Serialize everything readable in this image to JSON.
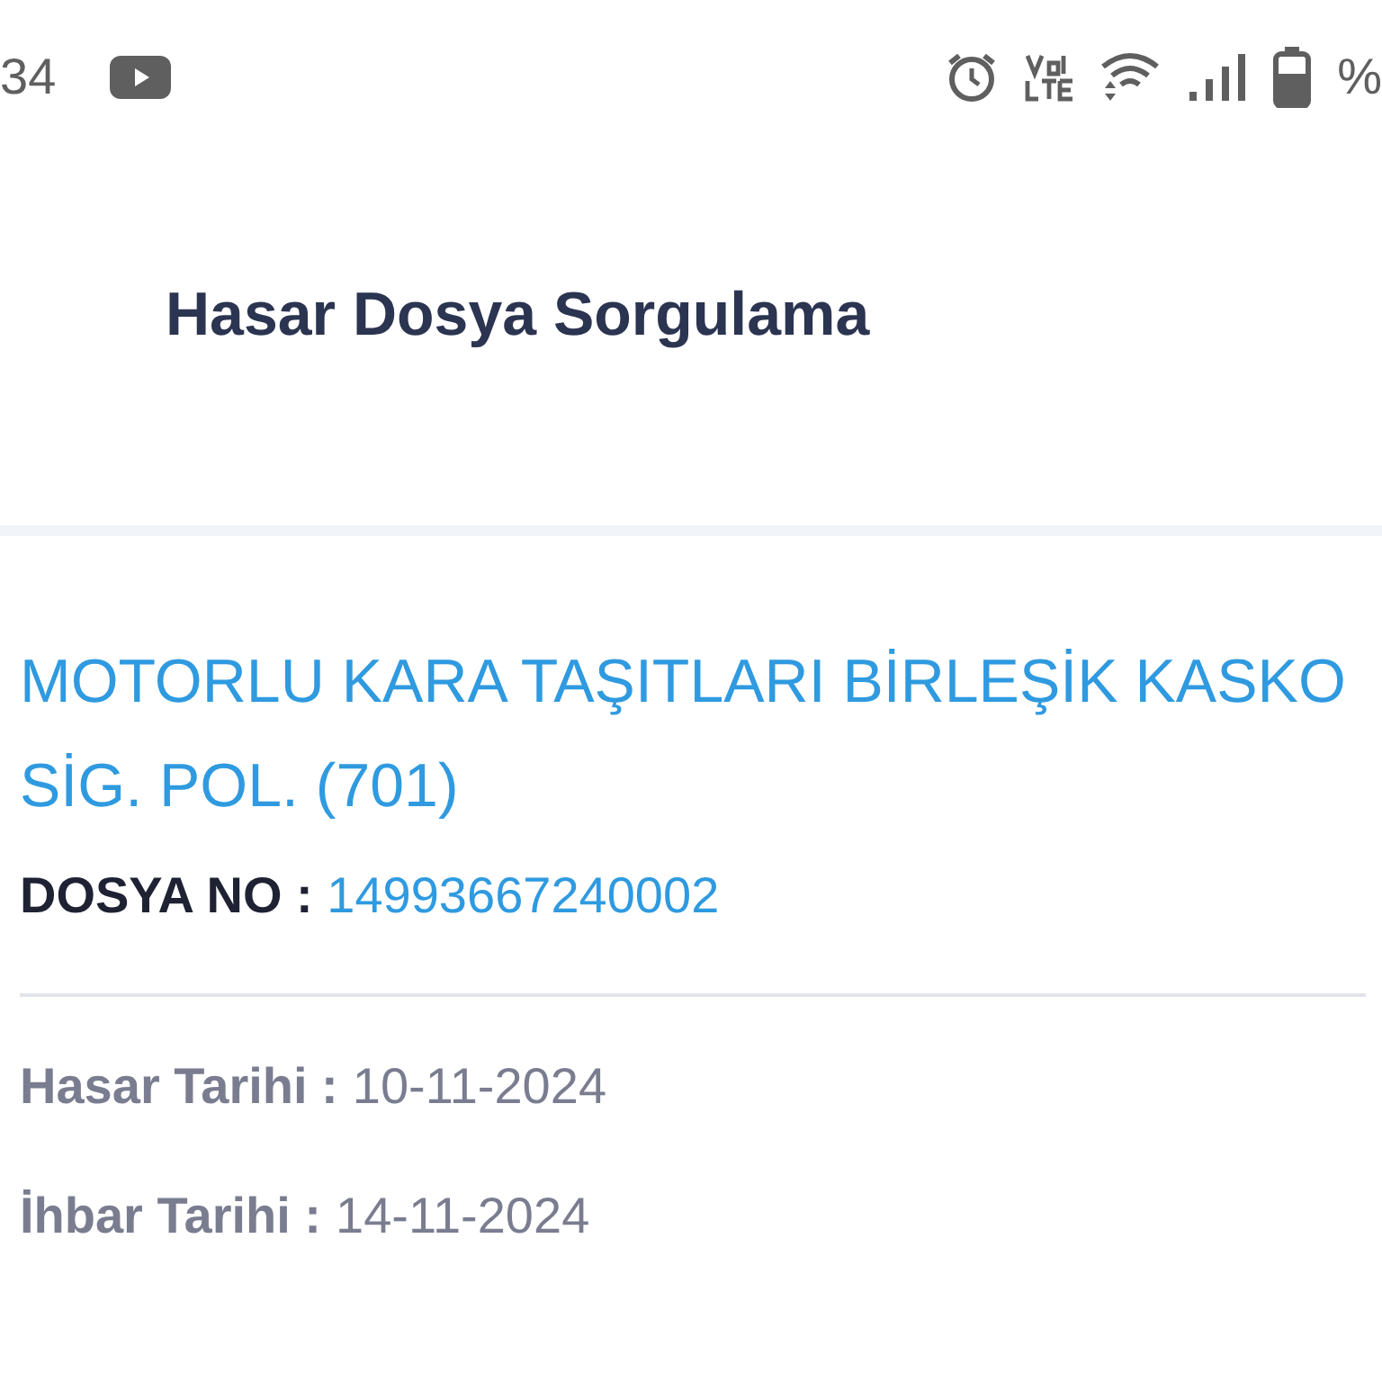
{
  "status_bar": {
    "time": "34",
    "battery_text": "%"
  },
  "header": {
    "title": "Hasar Dosya Sorgulama"
  },
  "claim": {
    "policy": "MOTORLU KARA TAŞITLARI BİRLEŞİK KASKO SİG. POL. (701)",
    "file_no_label": "DOSYA NO :",
    "file_no": "14993667240002",
    "dates": [
      {
        "label": "Hasar Tarihi :",
        "value": "10-11-2024"
      },
      {
        "label": "İhbar Tarihi :",
        "value": "14-11-2024"
      }
    ]
  }
}
